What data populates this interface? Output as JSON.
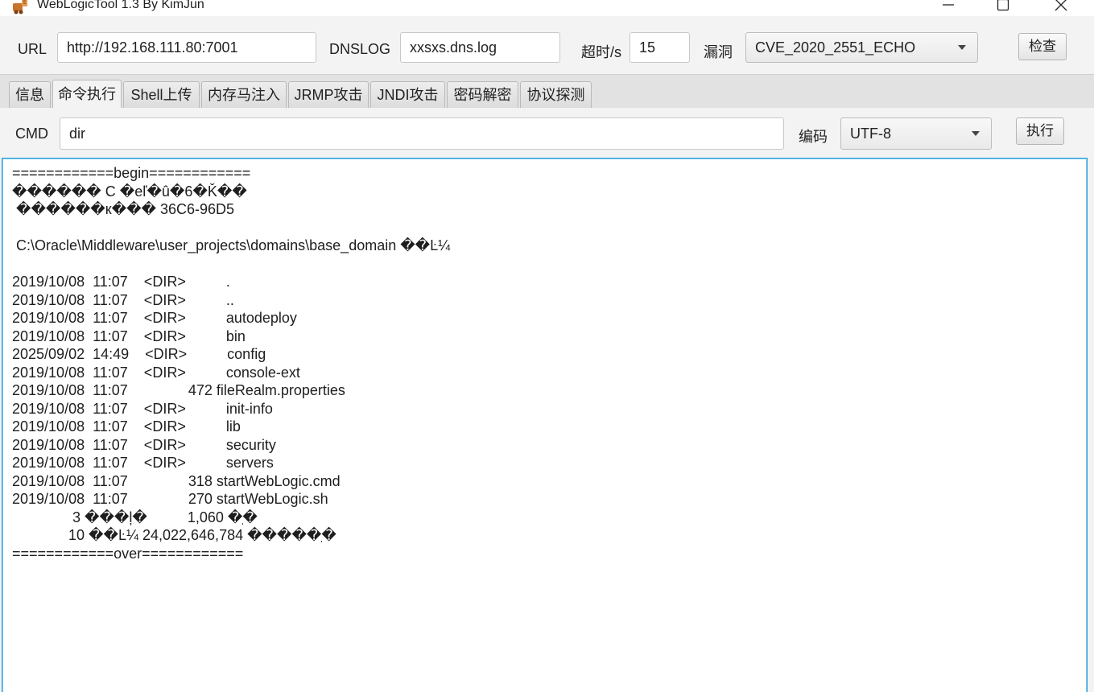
{
  "window": {
    "title": "WebLogicTool 1.3 By KimJun",
    "icon": "app-logo-icon"
  },
  "toolbar": {
    "url_label": "URL",
    "url_value": "http://192.168.111.80:7001",
    "dnslog_label": "DNSLOG",
    "dnslog_value": "xxsxs.dns.log",
    "timeout_label": "超时/s",
    "timeout_value": "15",
    "vuln_label": "漏洞",
    "vuln_value": "CVE_2020_2551_ECHO",
    "check_button": "检查"
  },
  "tabs": [
    {
      "label": "信息"
    },
    {
      "label": "命令执行"
    },
    {
      "label": "Shell上传"
    },
    {
      "label": "内存马注入"
    },
    {
      "label": "JRMP攻击"
    },
    {
      "label": "JNDI攻击"
    },
    {
      "label": "密码解密"
    },
    {
      "label": "协议探测"
    }
  ],
  "active_tab": "命令执行",
  "cmd": {
    "label": "CMD",
    "value": "dir",
    "encoding_label": "编码",
    "encoding_value": "UTF-8",
    "execute_button": "执行"
  },
  "output": {
    "lines": [
      "============begin============",
      "������ C �eľ�û�6�Ǩ��",
      " ������к��� 36C6-96D5",
      "",
      " C:\\Oracle\\Middleware\\user_projects\\domains\\base_domain ��Ŀ¼",
      "",
      "2019/10/08  11:07    <DIR>          .",
      "2019/10/08  11:07    <DIR>          ..",
      "2019/10/08  11:07    <DIR>          autodeploy",
      "2019/10/08  11:07    <DIR>          bin",
      "2025/09/02  14:49    <DIR>          config",
      "2019/10/08  11:07    <DIR>          console-ext",
      "2019/10/08  11:07               472 fileRealm.properties",
      "2019/10/08  11:07    <DIR>          init-info",
      "2019/10/08  11:07    <DIR>          lib",
      "2019/10/08  11:07    <DIR>          security",
      "2019/10/08  11:07    <DIR>          servers",
      "2019/10/08  11:07               318 startWebLogic.cmd",
      "2019/10/08  11:07               270 startWebLogic.sh",
      "               3 ���ļ�          1,060 �ֽ�",
      "              10 ��Ŀ¼ 24,022,646,784 �����ֽ�",
      "============over============"
    ]
  }
}
